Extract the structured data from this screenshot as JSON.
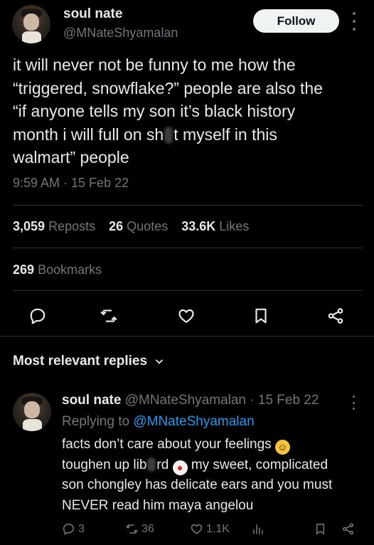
{
  "author": {
    "display_name": "soul nate",
    "handle": "@MNateShyamalan"
  },
  "follow_label": "Follow",
  "tweet": {
    "lines": [
      "it will never not be funny to me how the",
      "“triggered, snowflake?” people are also the",
      "“if anyone tells my son it’s black history",
      [
        "month i will full on sh",
        "t myself in this"
      ],
      "walmart” people"
    ],
    "timestamp": "9:59 AM · 15 Feb 22"
  },
  "stats": {
    "reposts_count": "3,059",
    "reposts_label": "Reposts",
    "quotes_count": "26",
    "quotes_label": "Quotes",
    "likes_count": "33.6K",
    "likes_label": "Likes",
    "bookmarks_count": "269",
    "bookmarks_label": "Bookmarks"
  },
  "actions": {
    "icons": [
      "reply-icon",
      "repost-icon",
      "like-icon",
      "bookmark-icon",
      "share-icon"
    ]
  },
  "replies_section": {
    "title": "Most relevant replies"
  },
  "reply": {
    "display_name": "soul nate",
    "handle_date": "@MNateShyamalan · 15 Feb 22",
    "replying_prefix": "Replying to",
    "replying_to": "@MNateShyamalan",
    "line1": "facts don’t care about your feelings",
    "line2a": "toughen up lib",
    "line2b": "rd",
    "line2c": "my sweet, complicated",
    "line3": "son chongley has delicate ears and you must",
    "line4": "NEVER read him maya angelou",
    "reply_count": "3",
    "repost_count": "36",
    "like_count": "1.1K"
  },
  "colors": {
    "background": "#000000",
    "text": "#e7e9ea",
    "muted": "#71767b",
    "accent": "#1d9bf0"
  }
}
